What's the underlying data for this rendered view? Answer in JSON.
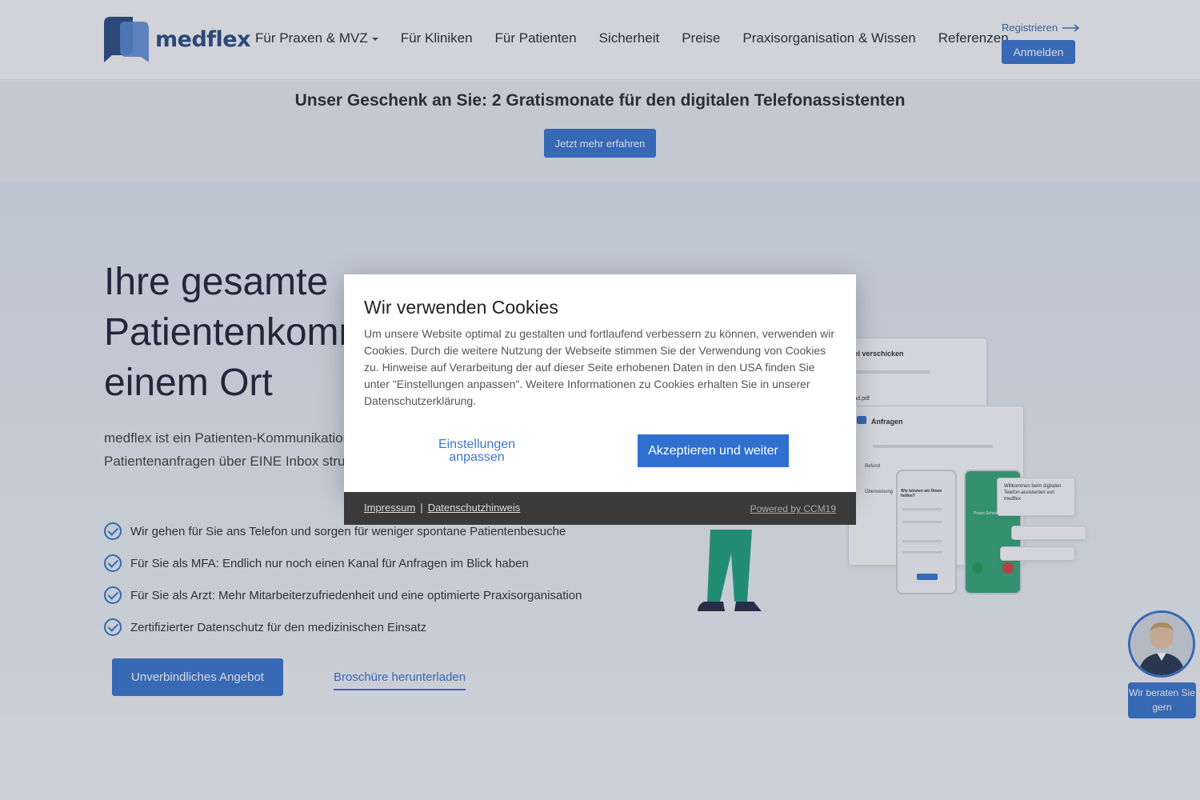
{
  "header": {
    "logo_text": "medflex",
    "nav": [
      {
        "label": "Für Praxen & MVZ",
        "has_dropdown": true
      },
      {
        "label": "Für Kliniken"
      },
      {
        "label": "Für Patienten"
      },
      {
        "label": "Sicherheit"
      },
      {
        "label": "Preise"
      },
      {
        "label": "Praxisorganisation & Wissen"
      },
      {
        "label": "Referenzen"
      }
    ],
    "register_label": "Registrieren",
    "login_label": "Anmelden"
  },
  "promo": {
    "title": "Unser Geschenk an Sie: 2 Gratismonate für den digitalen Telefonassistenten",
    "button_label": "Jetzt mehr erfahren"
  },
  "hero": {
    "title_lines": [
      "Ihre gesamte",
      "Patientenkommunikation an",
      "einem Ort"
    ],
    "text": "medflex ist ein Patienten-Kommunikationssystem, mit dem Sie alle Patientenanfragen über EINE Inbox strukturiert und digital bearbeiten können.",
    "bullets": [
      "Wir gehen für Sie ans Telefon und sorgen für weniger spontane Patientenbesuche",
      "Für Sie als MFA: Endlich nur noch einen Kanal für Anfragen im Blick haben",
      "Für Sie als Arzt: Mehr Mitarbeiterzufriedenheit und eine optimierte Praxisorganisation",
      "Zertifizierter Datenschutz für den medizinischen Einsatz"
    ],
    "offer_button": "Unverbindliches Angebot",
    "brochure_link": "Broschüre herunterladen"
  },
  "illustration": {
    "card1_title": "Datei verschicken",
    "card1_file": "Befund.pdf",
    "card2_title": "Anfragen",
    "card2_item1": "Befund",
    "card2_item2": "Überweisung",
    "phone_question": "Wie können wir Ihnen helfen?",
    "phone_caller": "Praxis Schmidt",
    "welcome_text": "Willkommen beim digitalen Telefon-assistenten von medflex"
  },
  "advisor": {
    "label": "Wir beraten Sie gern"
  },
  "cookie": {
    "title": "Wir verwenden Cookies",
    "text": "Um unsere Website optimal zu gestalten und fortlaufend verbessern zu können, verwenden wir Cookies. Durch die weitere Nutzung der Webseite stimmen Sie der Verwendung von Cookies zu. Hinweise auf Verarbeitung der auf dieser Seite erhobenen Daten in den USA finden Sie unter \"Einstellungen anpassen\". Weitere Informationen zu Cookies erhalten Sie in unserer Datenschutzerklärung.",
    "settings_label": "Einstellungen anpassen",
    "accept_label": "Akzeptieren und weiter",
    "impressum_label": "Impressum",
    "separator": "|",
    "privacy_label": "Datenschutzhinweis",
    "powered_label": "Powered by CCM19"
  },
  "colors": {
    "brand_blue": "#3b77d0",
    "logo_dark": "#2d4f86",
    "footer_bg": "#3a3a3a"
  }
}
